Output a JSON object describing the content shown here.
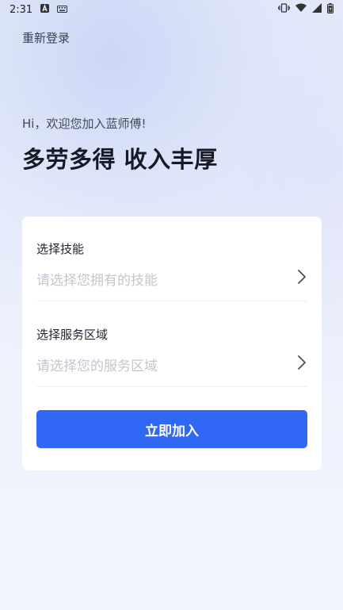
{
  "status_bar": {
    "time": "2:31",
    "icons": [
      "a-notification-icon",
      "keyboard-icon",
      "vibrate-icon",
      "wifi-icon",
      "signal-icon",
      "battery-icon"
    ]
  },
  "header": {
    "relogin_label": "重新登录"
  },
  "hero": {
    "greeting": "Hi，欢迎您加入蓝师傅!",
    "headline": "多劳多得 收入丰厚"
  },
  "form": {
    "skill": {
      "label": "选择技能",
      "placeholder": "请选择您拥有的技能"
    },
    "area": {
      "label": "选择服务区域",
      "placeholder": "请选择您的服务区域"
    },
    "submit_label": "立即加入"
  },
  "colors": {
    "accent": "#3068f5",
    "background": "#eef2fc",
    "card": "#ffffff",
    "placeholder": "#c2c6cf"
  }
}
